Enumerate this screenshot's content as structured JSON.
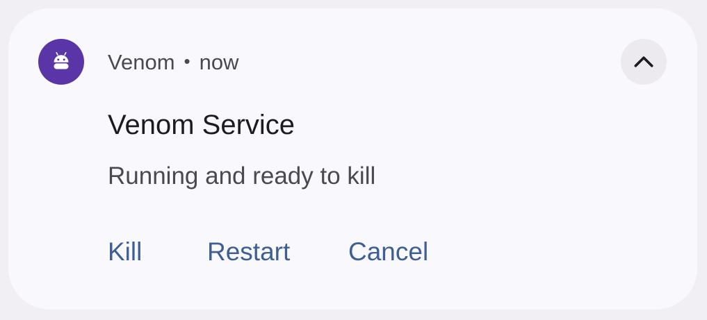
{
  "notification": {
    "app_name": "Venom",
    "separator": "•",
    "time": "now",
    "title": "Venom Service",
    "text": "Running and ready to kill",
    "app_icon": "android-icon",
    "expand_icon": "chevron-up-icon",
    "actions": [
      {
        "label": "Kill"
      },
      {
        "label": "Restart"
      },
      {
        "label": "Cancel"
      }
    ]
  },
  "colors": {
    "background": "#f1eff4",
    "card": "#f9f8fc",
    "icon_bg": "#5a35a8",
    "action_text": "#3e5e96",
    "title_text": "#1c1b1f",
    "secondary_text": "#4a4850"
  }
}
